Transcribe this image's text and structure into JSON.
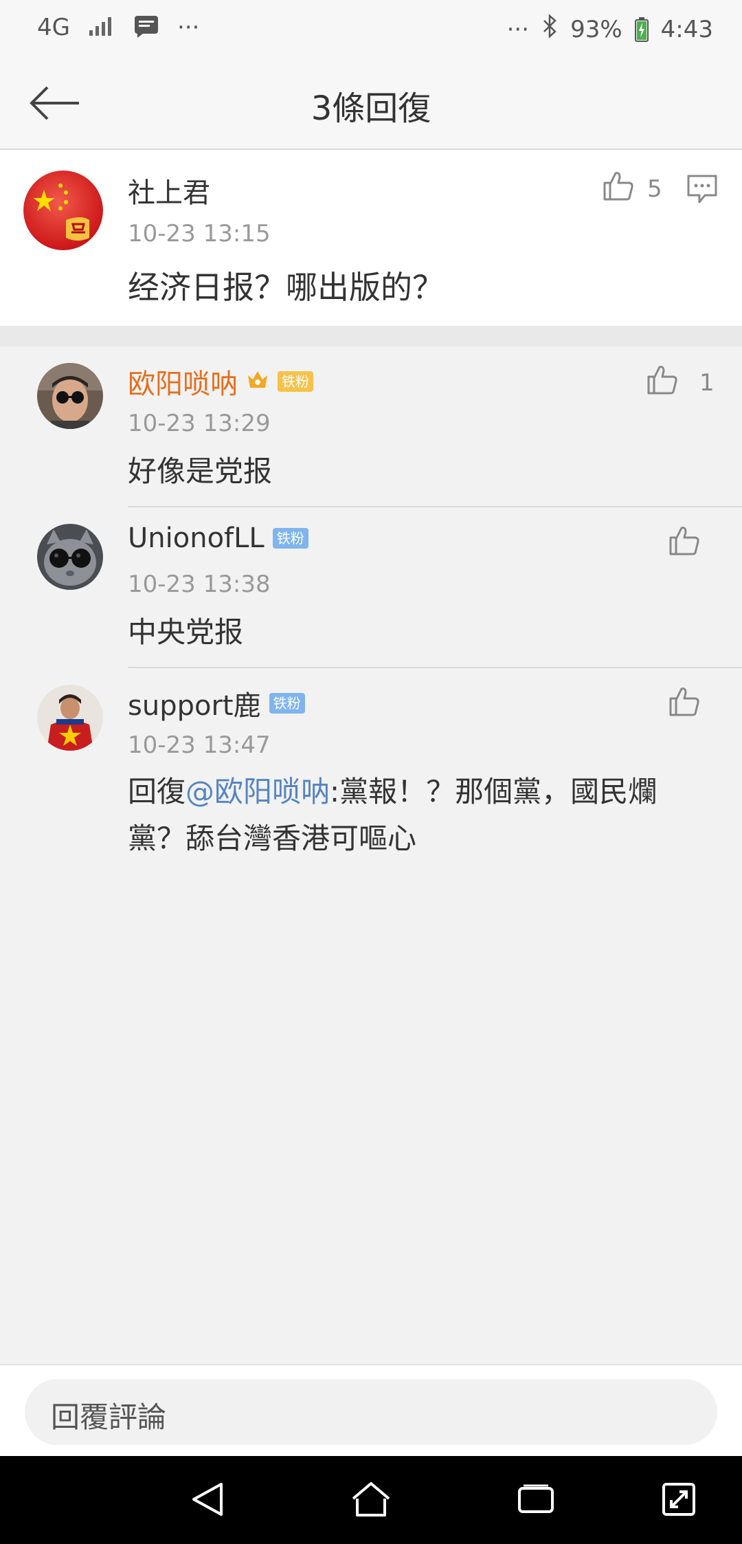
{
  "status_bar": {
    "network": "4G",
    "more_left": "···",
    "more_right": "···",
    "battery": "93%",
    "time": "4:43"
  },
  "header": {
    "title": "3條回復"
  },
  "main_comment": {
    "username": "社上君",
    "time": "10-23 13:15",
    "likes": "5",
    "text": "经济日报？哪出版的？"
  },
  "replies": [
    {
      "username": "欧阳唢呐",
      "badge": "铁粉",
      "time": "10-23 13:29",
      "likes": "1",
      "text": "好像是党报"
    },
    {
      "username": "UnionofLL",
      "badge": "铁粉",
      "time": "10-23 13:38",
      "likes": "",
      "text": "中央党报"
    },
    {
      "username": "support鹿",
      "badge": "铁粉",
      "time": "10-23 13:47",
      "likes": "",
      "prefix": "回復",
      "mention": "@欧阳唢呐",
      "text_line1": ":黨報！？那個黨，國民爛",
      "text_line2": "黨？舔台灣香港可嘔心"
    }
  ],
  "reply_input": {
    "placeholder": "回覆評論"
  },
  "colors": {
    "accent_name": "#e46f1e",
    "badge_blue": "#7fb4ee",
    "mention": "#5585c0"
  }
}
